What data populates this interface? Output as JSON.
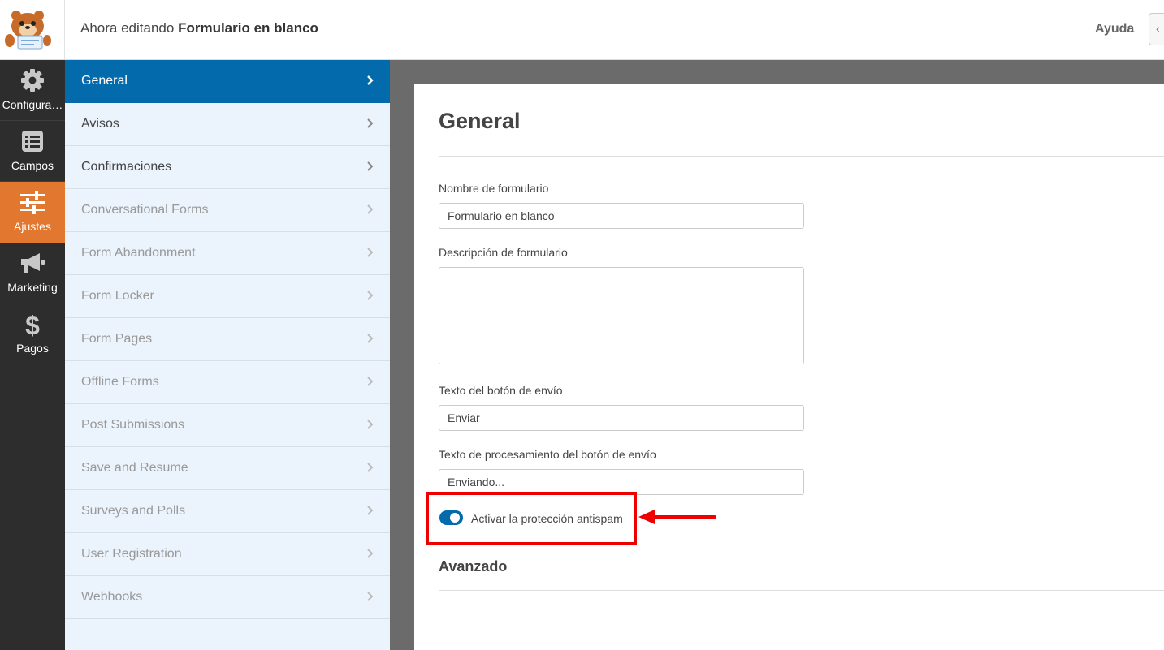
{
  "topbar": {
    "editing_prefix": "Ahora editando",
    "form_name": "Formulario en blanco",
    "help_label": "Ayuda"
  },
  "rail": {
    "items": [
      {
        "label": "Configura…",
        "icon": "gear-icon"
      },
      {
        "label": "Campos",
        "icon": "list-icon"
      },
      {
        "label": "Ajustes",
        "icon": "sliders-icon",
        "active": true
      },
      {
        "label": "Marketing",
        "icon": "megaphone-icon"
      },
      {
        "label": "Pagos",
        "icon": "dollar-icon"
      }
    ]
  },
  "subnav": {
    "items": [
      {
        "label": "General",
        "active": true
      },
      {
        "label": "Avisos"
      },
      {
        "label": "Confirmaciones"
      },
      {
        "label": "Conversational Forms",
        "muted": true
      },
      {
        "label": "Form Abandonment",
        "muted": true
      },
      {
        "label": "Form Locker",
        "muted": true
      },
      {
        "label": "Form Pages",
        "muted": true
      },
      {
        "label": "Offline Forms",
        "muted": true
      },
      {
        "label": "Post Submissions",
        "muted": true
      },
      {
        "label": "Save and Resume",
        "muted": true
      },
      {
        "label": "Surveys and Polls",
        "muted": true
      },
      {
        "label": "User Registration",
        "muted": true
      },
      {
        "label": "Webhooks",
        "muted": true
      }
    ]
  },
  "panel": {
    "title": "General",
    "form_name_label": "Nombre de formulario",
    "form_name_value": "Formulario en blanco",
    "description_label": "Descripción de formulario",
    "description_value": "",
    "submit_label": "Texto del botón de envío",
    "submit_value": "Enviar",
    "processing_label": "Texto de procesamiento del botón de envío",
    "processing_value": "Enviando...",
    "antispam_label": "Activar la protección antispam",
    "antispam_enabled": true,
    "advanced_title": "Avanzado"
  },
  "colors": {
    "accent_blue": "#036aab",
    "accent_orange": "#e27730",
    "rail_bg": "#2d2d2d",
    "subnav_bg": "#ebf3fc",
    "annotation_red": "#e00000"
  }
}
